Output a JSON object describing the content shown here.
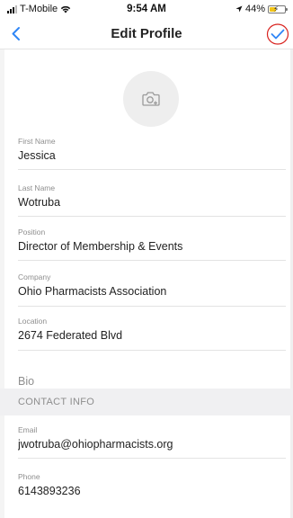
{
  "status_bar": {
    "carrier": "T-Mobile",
    "time": "9:54 AM",
    "battery_text": "44%",
    "battery_level": 0.44,
    "battery_color": "#f2c418"
  },
  "nav": {
    "title": "Edit Profile",
    "back_icon": "chevron-left-icon",
    "confirm_icon": "checkmark-icon",
    "accent": "#2f86f6",
    "highlight_circle": "#d9231f"
  },
  "avatar": {
    "icon": "camera-add-icon"
  },
  "profile": {
    "first_name": {
      "label": "First Name",
      "value": "Jessica"
    },
    "last_name": {
      "label": "Last Name",
      "value": "Wotruba"
    },
    "position": {
      "label": "Position",
      "value": "Director of Membership & Events"
    },
    "company": {
      "label": "Company",
      "value": "Ohio Pharmacists Association"
    },
    "location": {
      "label": "Location",
      "value": "2674 Federated Blvd"
    },
    "bio": {
      "placeholder": "Bio"
    }
  },
  "contact_section": {
    "title": "CONTACT INFO"
  },
  "contact": {
    "email": {
      "label": "Email",
      "value": "jwotruba@ohiopharmacists.org"
    },
    "phone": {
      "label": "Phone",
      "value": "6143893236"
    }
  }
}
